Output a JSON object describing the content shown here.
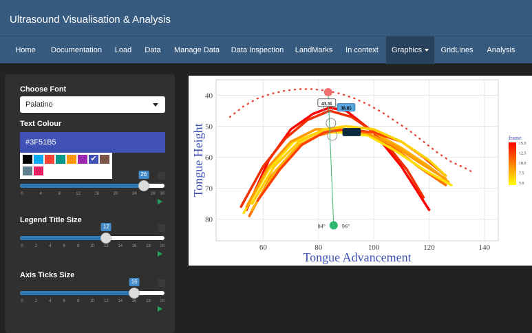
{
  "app": {
    "title": "Ultrasound Visualisation & Analysis"
  },
  "nav": {
    "items": [
      "Home",
      "Documentation",
      "Load",
      "Data",
      "Manage Data",
      "Data Inspection",
      "LandMarks",
      "In context",
      "Graphics",
      "GridLines",
      "Analysis"
    ],
    "active": "Graphics"
  },
  "sidebar": {
    "font_label": "Choose Font",
    "font_value": "Palatino",
    "colour_label": "Text Colour",
    "colour_value": "#3F51B5",
    "swatches": [
      "#000000",
      "#03a9f4",
      "#f44336",
      "#009688",
      "#ff9800",
      "#9c27b0",
      "#3f51b5",
      "#795548",
      "#607d8b",
      "#e91e63"
    ],
    "selected_swatch": "#3f51b5",
    "slider1": {
      "value": 26,
      "ticks": [
        "0",
        "4",
        "8",
        "12",
        "16",
        "20",
        "24",
        "28",
        "30"
      ],
      "max": 30
    },
    "legend_label": "Legend Title Size",
    "slider2": {
      "value": 12,
      "ticks": [
        "0",
        "2",
        "4",
        "6",
        "8",
        "10",
        "12",
        "14",
        "16",
        "18",
        "20"
      ],
      "max": 20
    },
    "axis_label": "Axis Ticks Size",
    "slider3": {
      "value": 16,
      "ticks": [
        "0",
        "2",
        "4",
        "6",
        "8",
        "10",
        "12",
        "14",
        "16",
        "18",
        "20"
      ],
      "max": 20
    }
  },
  "chart_data": {
    "type": "line",
    "xlabel": "Tongue Advancement",
    "ylabel": "Tongue Height",
    "xlim": [
      43,
      145
    ],
    "ylim": [
      87,
      35
    ],
    "xticks": [
      60,
      80,
      100,
      120,
      140
    ],
    "yticks": [
      40,
      50,
      60,
      70,
      80
    ],
    "grid": true,
    "axis_label_color": "#3f51b5",
    "legend": {
      "title": "frame",
      "ticks": [
        "15.0",
        "12.5",
        "10.0",
        "7.5",
        "5.0"
      ],
      "position": "right",
      "colors": [
        "#ff0000",
        "#ff8000",
        "#ffff00"
      ]
    },
    "palate": {
      "x": [
        48,
        53,
        58,
        63,
        68,
        73,
        78,
        83,
        88,
        93,
        98,
        103,
        108,
        113,
        118,
        123,
        128,
        133,
        136
      ],
      "y": [
        47,
        43.5,
        41,
        39.5,
        38.5,
        38,
        38,
        38.5,
        39.5,
        41,
        43,
        45.5,
        48.5,
        51.5,
        55,
        58.5,
        61.5,
        63.5,
        65
      ],
      "color": "#e74c3c"
    },
    "series": [
      {
        "x": [
          54,
          62,
          70,
          78,
          84,
          90,
          100,
          110,
          120
        ],
        "y": [
          77,
          61,
          51,
          46,
          44,
          45,
          52,
          63,
          77
        ],
        "color": "#ff0000"
      },
      {
        "x": [
          52,
          60,
          68,
          76,
          84,
          92,
          102,
          112,
          118
        ],
        "y": [
          76,
          63,
          54,
          48,
          45,
          47,
          53,
          64,
          73
        ],
        "color": "#f03000"
      },
      {
        "x": [
          55,
          63,
          72,
          80,
          88,
          96,
          106,
          116,
          126
        ],
        "y": [
          79,
          66,
          57,
          53,
          51,
          52,
          56,
          63,
          69
        ],
        "color": "#ff7000"
      },
      {
        "x": [
          56,
          64,
          73,
          82,
          90,
          100,
          110,
          120,
          127
        ],
        "y": [
          77,
          65,
          56,
          52,
          51,
          52,
          57,
          63,
          68
        ],
        "color": "#ffb000"
      },
      {
        "x": [
          53,
          62,
          71,
          80,
          88,
          98,
          108,
          118,
          128
        ],
        "y": [
          78,
          64,
          55,
          52,
          52,
          53,
          58,
          64,
          69
        ],
        "color": "#ffe000"
      },
      {
        "x": [
          54,
          62,
          70,
          79,
          87,
          97,
          107,
          117,
          126
        ],
        "y": [
          76,
          63,
          55,
          51,
          51,
          52,
          56,
          62,
          67
        ],
        "color": "#ff9a00"
      },
      {
        "x": [
          58,
          66,
          74,
          82,
          90,
          100,
          110,
          118,
          126
        ],
        "y": [
          74,
          64,
          56,
          52,
          51,
          52,
          55,
          60,
          66
        ],
        "color": "#ff4000"
      },
      {
        "x": [
          56,
          64,
          73,
          82,
          90,
          100,
          110,
          120,
          126
        ],
        "y": [
          75,
          63,
          55,
          51,
          50,
          51,
          55,
          61,
          66
        ],
        "color": "#ffd000"
      }
    ],
    "annotations": [
      {
        "text": "43.31",
        "x": 83,
        "y": 42.5,
        "style": "white"
      },
      {
        "text": "38.85",
        "x": 90,
        "y": 44,
        "style": "blue"
      },
      {
        "text": "",
        "x": 92,
        "y": 52,
        "style": "dark"
      }
    ],
    "origin": {
      "x": 85.5,
      "y": 82,
      "color": "#2eb872"
    },
    "top_marker": {
      "x": 83.5,
      "y": 39,
      "color": "#f07070"
    },
    "circles": [
      {
        "x": 83.5,
        "y": 44
      },
      {
        "x": 84.5,
        "y": 49
      },
      {
        "x": 85,
        "y": 53
      }
    ],
    "angle_labels": [
      "84°",
      "96°"
    ]
  }
}
